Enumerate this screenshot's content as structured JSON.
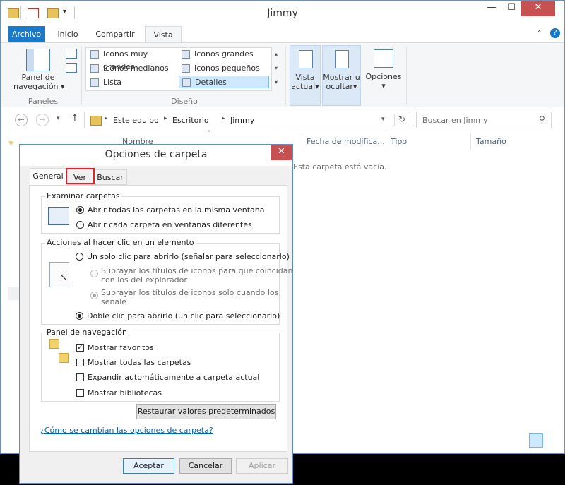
{
  "window": {
    "title": "Jimmy",
    "controls": {
      "minimize": "—",
      "maximize": "☐",
      "close": "✕"
    }
  },
  "ribbon_tabs": [
    "Archivo",
    "Inicio",
    "Compartir",
    "Vista"
  ],
  "ribbon": {
    "panes_button": {
      "line1": "Panel de",
      "line2": "navegación",
      "group": "Paneles"
    },
    "layout": {
      "items": [
        "Iconos muy grandes",
        "Iconos grandes",
        "Iconos medianos",
        "Iconos pequeños",
        "Lista",
        "Detalles"
      ],
      "selected": "Detalles",
      "group": "Diseño"
    },
    "current_view": {
      "line1": "Vista",
      "line2": "actual"
    },
    "show_hide": {
      "line1": "Mostrar u",
      "line2": "ocultar"
    },
    "options": {
      "label": "Opciones"
    }
  },
  "address": {
    "crumbs": [
      "Este equipo",
      "Escritorio",
      "Jimmy"
    ],
    "search_placeholder": "Buscar en Jimmy"
  },
  "columns": [
    "Nombre",
    "Fecha de modifica...",
    "Tipo",
    "Tamaño"
  ],
  "empty_message": "Esta carpeta está vacía.",
  "dialog": {
    "title": "Opciones de carpeta",
    "close": "✕",
    "tabs": [
      "General",
      "Ver",
      "Buscar"
    ],
    "browse": {
      "legend": "Examinar carpetas",
      "options": [
        "Abrir todas las carpetas en la misma ventana",
        "Abrir cada carpeta en ventanas diferentes"
      ],
      "selected_index": 0
    },
    "click": {
      "legend": "Acciones al hacer clic en un elemento",
      "single": "Un solo clic para abrirlo (señalar para seleccionarlo)",
      "sub1_l1": "Subrayar los títulos de iconos para que coincidan",
      "sub1_l2": "con los del explorador",
      "sub2_l1": "Subrayar los títulos de iconos solo cuando los",
      "sub2_l2": "señale",
      "double": "Doble clic para abrirlo (un clic para seleccionarlo)"
    },
    "nav": {
      "legend": "Panel de navegación",
      "items": [
        {
          "label": "Mostrar favoritos",
          "checked": true
        },
        {
          "label": "Mostrar todas las carpetas",
          "checked": false
        },
        {
          "label": "Expandir automáticamente a carpeta actual",
          "checked": false
        },
        {
          "label": "Mostrar bibliotecas",
          "checked": false
        }
      ]
    },
    "restore_button": "Restaurar valores predeterminados",
    "help_link": "¿Cómo se cambian las opciones de carpeta?",
    "buttons": {
      "ok": "Aceptar",
      "cancel": "Cancelar",
      "apply": "Aplicar"
    }
  },
  "colors": {
    "file_tab": "#1979ca",
    "highlight": "#e0202a",
    "close": "#c75050"
  }
}
